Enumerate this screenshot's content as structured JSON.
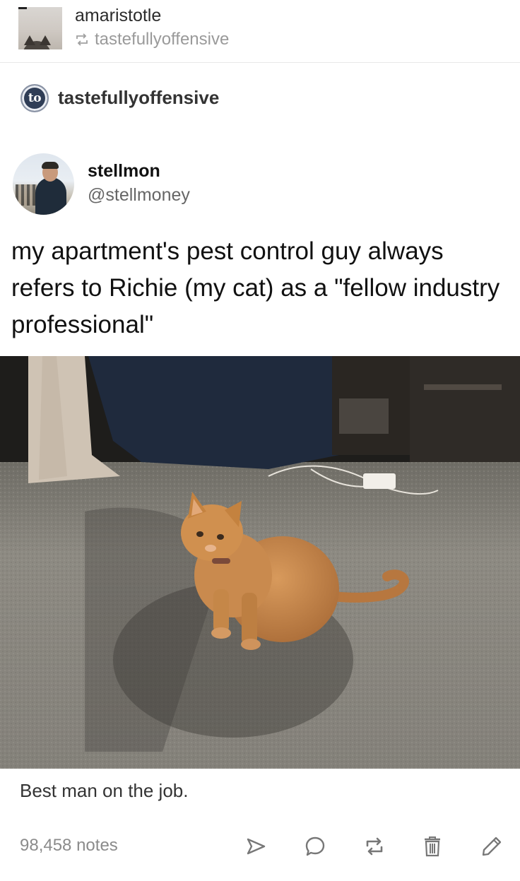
{
  "reblog_header": {
    "reblogger": "amaristotle",
    "reblogged_from": "tastefullyoffensive"
  },
  "source": {
    "avatar_text": "to",
    "name": "tastefullyoffensive"
  },
  "tweet": {
    "display_name": "stellmon",
    "handle": "@stellmoney",
    "text": "my apartment's pest control guy always refers to Richie (my cat) as a \"fellow industry professional\""
  },
  "photo": {
    "icon": "cat-photo"
  },
  "caption": "Best man on the job.",
  "footer": {
    "notes": "98,458 notes",
    "actions": [
      "share-icon",
      "reply-icon",
      "reblog-icon",
      "delete-icon",
      "edit-icon"
    ]
  },
  "colors": {
    "muted_text": "#9a9a9a",
    "icon_gray": "#777777",
    "source_avatar_bg": "#2f3d56"
  }
}
